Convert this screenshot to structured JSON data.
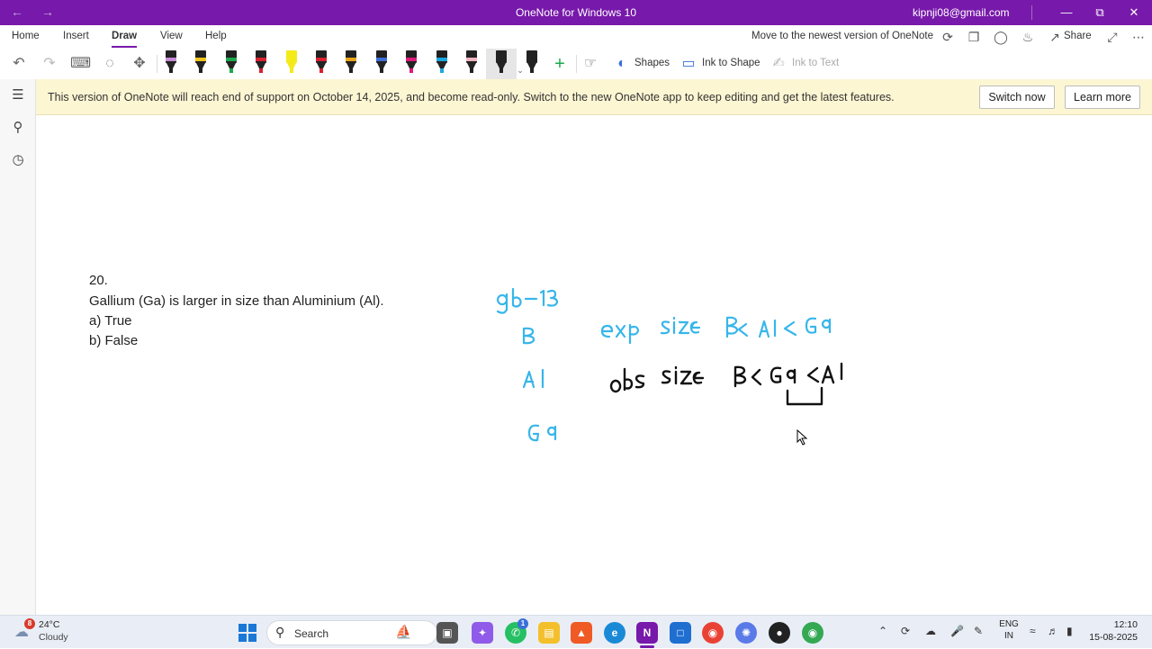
{
  "titlebar": {
    "title": "OneNote for Windows 10",
    "account": "kipnji08@gmail.com"
  },
  "menu": {
    "tabs": [
      "Home",
      "Insert",
      "Draw",
      "View",
      "Help"
    ],
    "active_tab": "Draw",
    "move_to_new": "Move to the newest version of OneNote",
    "share_label": "Share"
  },
  "toolbar": {
    "shapes_label": "Shapes",
    "ink_to_shape_label": "Ink to Shape",
    "ink_to_text_label": "Ink to Text",
    "pens": [
      {
        "body": "#222222",
        "band": "#c48ad6",
        "tip": "#222222"
      },
      {
        "body": "#222222",
        "band": "#f0c419",
        "tip": "#222222"
      },
      {
        "body": "#222222",
        "band": "#1aa84a",
        "tip": "#1aa84a"
      },
      {
        "body": "#222222",
        "band": "#d92030",
        "tip": "#d92030"
      },
      {
        "body": "#f4ea1a",
        "band": "#f4ea1a",
        "tip": "#f4ea1a"
      },
      {
        "body": "#222222",
        "band": "#d92030",
        "tip": "#d92030"
      },
      {
        "body": "#222222",
        "band": "#e8a317",
        "tip": "#222222"
      },
      {
        "body": "#222222",
        "band": "#3a6fd8",
        "tip": "#222222"
      },
      {
        "body": "#222222",
        "band": "#e0197a",
        "tip": "#e0197a"
      },
      {
        "body": "#222222",
        "band": "#19a7e0",
        "tip": "#19a7e0"
      },
      {
        "body": "#222222",
        "band": "#f0b3c0",
        "tip": "#222222"
      },
      {
        "body": "#222222",
        "band": "#222222",
        "tip": "#222222"
      },
      {
        "body": "#222222",
        "band": "#222222",
        "tip": "#222222"
      }
    ]
  },
  "banner": {
    "message": "This version of OneNote will reach end of support on October 14, 2025, and become read-only. Switch to the new OneNote app to keep editing and get the latest features.",
    "switch_now": "Switch now",
    "learn_more": "Learn more",
    "background": "#fdf6d3"
  },
  "page": {
    "question_number": "20.",
    "question": "Gallium (Ga) is larger in size than Aluminium (Al).",
    "option_a": "a) True",
    "option_b": "b) False",
    "ink": {
      "blue_color": "#37b6ea",
      "black_color": "#111111",
      "group_label": "gb-13",
      "elements": [
        "B",
        "Al",
        "Ga"
      ],
      "expected_line": "exp size  B< Al< Ga",
      "observed_line": "obs size  B < Ga < Al"
    }
  },
  "taskbar": {
    "temperature": "24°C",
    "condition": "Cloudy",
    "weather_badge": "8",
    "search_label": "Search",
    "language_top": "ENG",
    "language_bottom": "IN",
    "time": "12:10",
    "date": "15-08-2025"
  },
  "colors": {
    "titlebar": "#7719aa",
    "accent": "#7719aa"
  }
}
